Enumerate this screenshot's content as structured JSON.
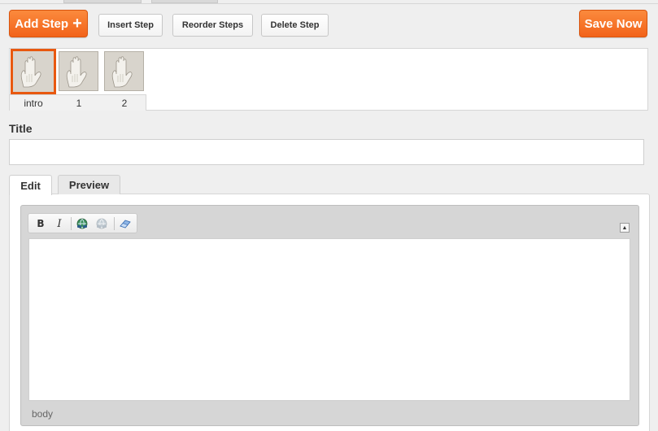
{
  "toolbar": {
    "add_step_label": "Add Step",
    "add_step_icon": "plus-icon",
    "insert_step_label": "Insert Step",
    "reorder_steps_label": "Reorder Steps",
    "delete_step_label": "Delete Step",
    "save_now_label": "Save Now"
  },
  "steps": [
    {
      "label": "intro",
      "selected": true,
      "icon": "hand-image"
    },
    {
      "label": "1",
      "selected": false,
      "icon": "hand-image"
    },
    {
      "label": "2",
      "selected": false,
      "icon": "hand-image"
    }
  ],
  "title_field": {
    "label": "Title",
    "value": ""
  },
  "tabs": [
    {
      "label": "Edit",
      "active": true
    },
    {
      "label": "Preview",
      "active": false
    }
  ],
  "editor": {
    "buttons": [
      {
        "label": "B",
        "icon": "bold-icon"
      },
      {
        "label": "I",
        "icon": "italic-icon"
      },
      {
        "icon": "link-icon"
      },
      {
        "icon": "unlink-icon"
      },
      {
        "icon": "eraser-icon"
      }
    ],
    "collapse_icon": "collapse-up-icon",
    "content": "",
    "path": "body"
  },
  "colors": {
    "accent": "#f26a1b",
    "selected_border": "#e8580f"
  }
}
